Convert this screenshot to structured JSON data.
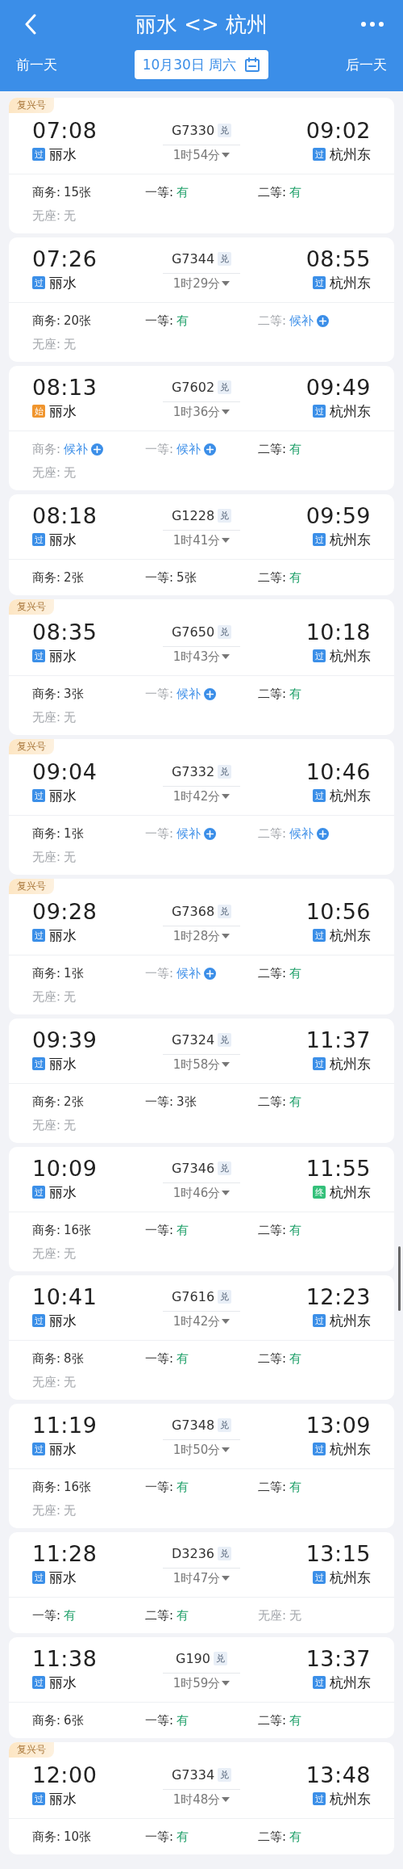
{
  "header": {
    "title": "丽水 <> 杭州",
    "prev_day": "前一天",
    "date": "10月30日 周六",
    "next_day": "后一天"
  },
  "trains": [
    {
      "badge": "复兴号",
      "depart_time": "07:08",
      "depart_station": {
        "tag": "过",
        "color": "#3b8fe8",
        "name": "丽水"
      },
      "train_no": "G7330",
      "exchange": "兑",
      "duration": "1时54分",
      "arrive_time": "09:02",
      "arrive_station": {
        "tag": "过",
        "color": "#3b8fe8",
        "name": "杭州东"
      },
      "seats": [
        {
          "label": "商务:",
          "value": "15张",
          "kind": "count"
        },
        {
          "label": "一等:",
          "value": "有",
          "kind": "available"
        },
        {
          "label": "二等:",
          "value": "有",
          "kind": "available"
        },
        {
          "label": "无座:",
          "value": "无",
          "kind": "none"
        }
      ]
    },
    {
      "depart_time": "07:26",
      "depart_station": {
        "tag": "过",
        "color": "#3b8fe8",
        "name": "丽水"
      },
      "train_no": "G7344",
      "exchange": "兑",
      "duration": "1时29分",
      "arrive_time": "08:55",
      "arrive_station": {
        "tag": "过",
        "color": "#3b8fe8",
        "name": "杭州东"
      },
      "seats": [
        {
          "label": "商务:",
          "value": "20张",
          "kind": "count"
        },
        {
          "label": "一等:",
          "value": "有",
          "kind": "available"
        },
        {
          "label": "二等:",
          "value": "候补",
          "kind": "waitlist"
        },
        {
          "label": "无座:",
          "value": "无",
          "kind": "none"
        }
      ]
    },
    {
      "depart_time": "08:13",
      "depart_station": {
        "tag": "始",
        "color": "#f0952e",
        "name": "丽水"
      },
      "train_no": "G7602",
      "exchange": "兑",
      "duration": "1时36分",
      "arrive_time": "09:49",
      "arrive_station": {
        "tag": "过",
        "color": "#3b8fe8",
        "name": "杭州东"
      },
      "seats": [
        {
          "label": "商务:",
          "value": "候补",
          "kind": "waitlist"
        },
        {
          "label": "一等:",
          "value": "候补",
          "kind": "waitlist"
        },
        {
          "label": "二等:",
          "value": "有",
          "kind": "available"
        },
        {
          "label": "无座:",
          "value": "无",
          "kind": "none"
        }
      ]
    },
    {
      "depart_time": "08:18",
      "depart_station": {
        "tag": "过",
        "color": "#3b8fe8",
        "name": "丽水"
      },
      "train_no": "G1228",
      "exchange": "兑",
      "duration": "1时41分",
      "arrive_time": "09:59",
      "arrive_station": {
        "tag": "过",
        "color": "#3b8fe8",
        "name": "杭州东"
      },
      "seats": [
        {
          "label": "商务:",
          "value": "2张",
          "kind": "count"
        },
        {
          "label": "一等:",
          "value": "5张",
          "kind": "count"
        },
        {
          "label": "二等:",
          "value": "有",
          "kind": "available"
        }
      ]
    },
    {
      "badge": "复兴号",
      "depart_time": "08:35",
      "depart_station": {
        "tag": "过",
        "color": "#3b8fe8",
        "name": "丽水"
      },
      "train_no": "G7650",
      "exchange": "兑",
      "duration": "1时43分",
      "arrive_time": "10:18",
      "arrive_station": {
        "tag": "过",
        "color": "#3b8fe8",
        "name": "杭州东"
      },
      "seats": [
        {
          "label": "商务:",
          "value": "3张",
          "kind": "count"
        },
        {
          "label": "一等:",
          "value": "候补",
          "kind": "waitlist"
        },
        {
          "label": "二等:",
          "value": "有",
          "kind": "available"
        },
        {
          "label": "无座:",
          "value": "无",
          "kind": "none"
        }
      ]
    },
    {
      "badge": "复兴号",
      "depart_time": "09:04",
      "depart_station": {
        "tag": "过",
        "color": "#3b8fe8",
        "name": "丽水"
      },
      "train_no": "G7332",
      "exchange": "兑",
      "duration": "1时42分",
      "arrive_time": "10:46",
      "arrive_station": {
        "tag": "过",
        "color": "#3b8fe8",
        "name": "杭州东"
      },
      "seats": [
        {
          "label": "商务:",
          "value": "1张",
          "kind": "count"
        },
        {
          "label": "一等:",
          "value": "候补",
          "kind": "waitlist"
        },
        {
          "label": "二等:",
          "value": "候补",
          "kind": "waitlist"
        },
        {
          "label": "无座:",
          "value": "无",
          "kind": "none"
        }
      ]
    },
    {
      "badge": "复兴号",
      "depart_time": "09:28",
      "depart_station": {
        "tag": "过",
        "color": "#3b8fe8",
        "name": "丽水"
      },
      "train_no": "G7368",
      "exchange": "兑",
      "duration": "1时28分",
      "arrive_time": "10:56",
      "arrive_station": {
        "tag": "过",
        "color": "#3b8fe8",
        "name": "杭州东"
      },
      "seats": [
        {
          "label": "商务:",
          "value": "1张",
          "kind": "count"
        },
        {
          "label": "一等:",
          "value": "候补",
          "kind": "waitlist"
        },
        {
          "label": "二等:",
          "value": "有",
          "kind": "available"
        },
        {
          "label": "无座:",
          "value": "无",
          "kind": "none"
        }
      ]
    },
    {
      "depart_time": "09:39",
      "depart_station": {
        "tag": "过",
        "color": "#3b8fe8",
        "name": "丽水"
      },
      "train_no": "G7324",
      "exchange": "兑",
      "duration": "1时58分",
      "arrive_time": "11:37",
      "arrive_station": {
        "tag": "过",
        "color": "#3b8fe8",
        "name": "杭州东"
      },
      "seats": [
        {
          "label": "商务:",
          "value": "2张",
          "kind": "count"
        },
        {
          "label": "一等:",
          "value": "3张",
          "kind": "count"
        },
        {
          "label": "二等:",
          "value": "有",
          "kind": "available"
        },
        {
          "label": "无座:",
          "value": "无",
          "kind": "none"
        }
      ]
    },
    {
      "depart_time": "10:09",
      "depart_station": {
        "tag": "过",
        "color": "#3b8fe8",
        "name": "丽水"
      },
      "train_no": "G7346",
      "exchange": "兑",
      "duration": "1时46分",
      "arrive_time": "11:55",
      "arrive_station": {
        "tag": "终",
        "color": "#34c07a",
        "name": "杭州东"
      },
      "seats": [
        {
          "label": "商务:",
          "value": "16张",
          "kind": "count"
        },
        {
          "label": "一等:",
          "value": "有",
          "kind": "available"
        },
        {
          "label": "二等:",
          "value": "有",
          "kind": "available"
        },
        {
          "label": "无座:",
          "value": "无",
          "kind": "none"
        }
      ]
    },
    {
      "depart_time": "10:41",
      "depart_station": {
        "tag": "过",
        "color": "#3b8fe8",
        "name": "丽水"
      },
      "train_no": "G7616",
      "exchange": "兑",
      "duration": "1时42分",
      "arrive_time": "12:23",
      "arrive_station": {
        "tag": "过",
        "color": "#3b8fe8",
        "name": "杭州东"
      },
      "seats": [
        {
          "label": "商务:",
          "value": "8张",
          "kind": "count"
        },
        {
          "label": "一等:",
          "value": "有",
          "kind": "available"
        },
        {
          "label": "二等:",
          "value": "有",
          "kind": "available"
        },
        {
          "label": "无座:",
          "value": "无",
          "kind": "none"
        }
      ]
    },
    {
      "depart_time": "11:19",
      "depart_station": {
        "tag": "过",
        "color": "#3b8fe8",
        "name": "丽水"
      },
      "train_no": "G7348",
      "exchange": "兑",
      "duration": "1时50分",
      "arrive_time": "13:09",
      "arrive_station": {
        "tag": "过",
        "color": "#3b8fe8",
        "name": "杭州东"
      },
      "seats": [
        {
          "label": "商务:",
          "value": "16张",
          "kind": "count"
        },
        {
          "label": "一等:",
          "value": "有",
          "kind": "available"
        },
        {
          "label": "二等:",
          "value": "有",
          "kind": "available"
        },
        {
          "label": "无座:",
          "value": "无",
          "kind": "none"
        }
      ]
    },
    {
      "depart_time": "11:28",
      "depart_station": {
        "tag": "过",
        "color": "#3b8fe8",
        "name": "丽水"
      },
      "train_no": "D3236",
      "exchange": "兑",
      "duration": "1时47分",
      "arrive_time": "13:15",
      "arrive_station": {
        "tag": "过",
        "color": "#3b8fe8",
        "name": "杭州东"
      },
      "seats": [
        {
          "label": "一等:",
          "value": "有",
          "kind": "available"
        },
        {
          "label": "二等:",
          "value": "有",
          "kind": "available"
        },
        {
          "label": "无座:",
          "value": "无",
          "kind": "none"
        }
      ]
    },
    {
      "depart_time": "11:38",
      "depart_station": {
        "tag": "过",
        "color": "#3b8fe8",
        "name": "丽水"
      },
      "train_no": "G190",
      "exchange": "兑",
      "duration": "1时59分",
      "arrive_time": "13:37",
      "arrive_station": {
        "tag": "过",
        "color": "#3b8fe8",
        "name": "杭州东"
      },
      "seats": [
        {
          "label": "商务:",
          "value": "6张",
          "kind": "count"
        },
        {
          "label": "一等:",
          "value": "有",
          "kind": "available"
        },
        {
          "label": "二等:",
          "value": "有",
          "kind": "available"
        }
      ]
    },
    {
      "badge": "复兴号",
      "depart_time": "12:00",
      "depart_station": {
        "tag": "过",
        "color": "#3b8fe8",
        "name": "丽水"
      },
      "train_no": "G7334",
      "exchange": "兑",
      "duration": "1时48分",
      "arrive_time": "13:48",
      "arrive_station": {
        "tag": "过",
        "color": "#3b8fe8",
        "name": "杭州东"
      },
      "seats": [
        {
          "label": "商务:",
          "value": "10张",
          "kind": "count"
        },
        {
          "label": "一等:",
          "value": "有",
          "kind": "available"
        },
        {
          "label": "二等:",
          "value": "有",
          "kind": "available"
        }
      ]
    }
  ]
}
